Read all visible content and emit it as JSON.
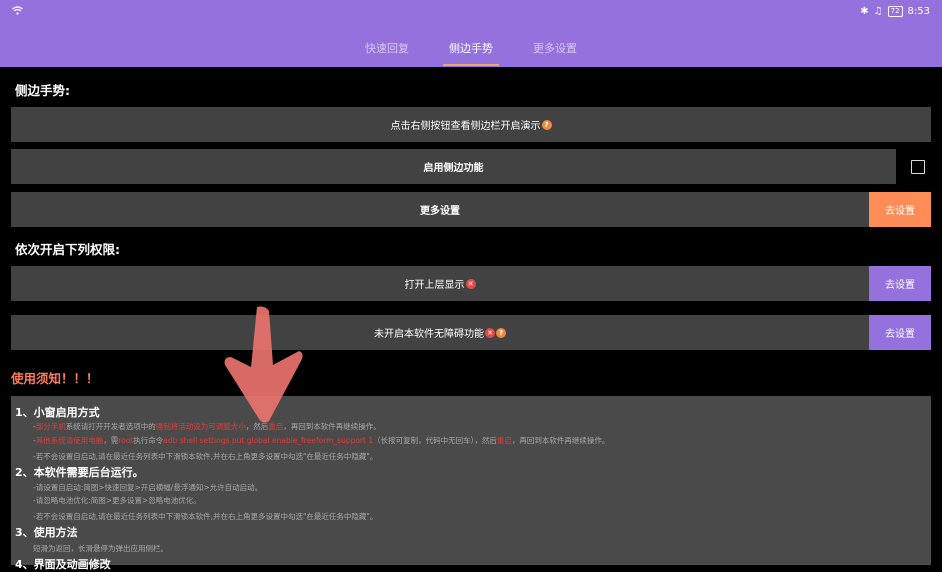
{
  "status_bar": {
    "time": "8:53",
    "battery": "72"
  },
  "tabs": [
    {
      "label": "快速回复"
    },
    {
      "label": "侧边手势"
    },
    {
      "label": "更多设置"
    }
  ],
  "side_gesture": {
    "title": "侧边手势:",
    "demo_label": "点击右侧按钮查看侧边栏开启演示",
    "enable_label": "启用侧边功能",
    "more_label": "更多设置",
    "more_button": "去设置"
  },
  "permissions": {
    "title": "依次开启下列权限:",
    "overlay_label": "打开上层显示",
    "overlay_button": "去设置",
    "accessibility_label": "未开启本软件无障碍功能",
    "accessibility_button": "去设置"
  },
  "notice": {
    "title": "使用须知！！！",
    "s1_title": "1、小窗启用方式",
    "s1_l1a": "部分手机",
    "s1_l1b": "系统请打开开发者选项中的",
    "s1_l1c": "强制将活动设为可调整大小",
    "s1_l1d": "，然后",
    "s1_l1e": "重启",
    "s1_l1f": "，再回到本软件再继续操作。",
    "s1_l2a": "其他系统请使用电脑",
    "s1_l2b": "，需",
    "s1_l2c": "root",
    "s1_l2d": "执行命令",
    "s1_l2e": "adb shell settings put global enable_freeform_support 1",
    "s1_l2f": "（长按可复制，代码中无回车），然后",
    "s1_l2g": "重启",
    "s1_l2h": "，再回到本软件再继续操作。",
    "s1_l3": "-若不会设置自启动,请在最近任务列表中下滑锁本软件,并在右上角更多设置中勾选\"在最近任务中隐藏\"。",
    "s2_title": "2、本软件需要后台运行。",
    "s2_l1": "-请设置自启动:简图>快速回复>开启横幅/悬浮通知>允许自动启动。",
    "s2_l2": "-请忽略电池优化:简图>更多设置>忽略电池优化。",
    "s2_l3": "-若不会设置自启动,请在最近任务列表中下滑锁本软件,并在右上角更多设置中勾选\"在最近任务中隐藏\"。",
    "s3_title": "3、使用方法",
    "s3_l1": "短滑为返回，长滑悬停为弹出应用侧栏。",
    "s4_title": "4、界面及动画修改"
  },
  "colors": {
    "accent": "#9471dd",
    "orange": "#fd8c57",
    "panel": "#424242"
  }
}
